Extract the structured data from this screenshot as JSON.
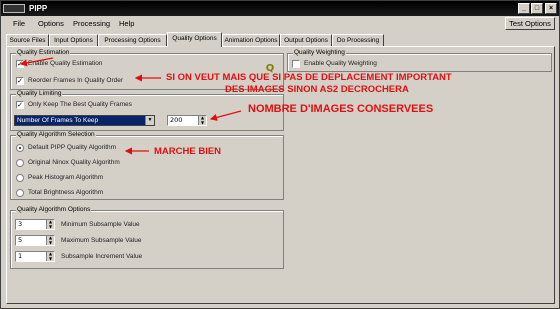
{
  "window": {
    "title": "PIPP",
    "minimize": "_",
    "maximize": "□",
    "close": "×"
  },
  "menu": {
    "file": "File",
    "options": "Options",
    "processing": "Processing",
    "help": "Help",
    "test_options": "Test Options"
  },
  "tabs": [
    {
      "label": "Source Files"
    },
    {
      "label": "Input Options"
    },
    {
      "label": "Processing Options"
    },
    {
      "label": "Quality Options"
    },
    {
      "label": "Animation Options"
    },
    {
      "label": "Output Options"
    },
    {
      "label": "Do Processing"
    }
  ],
  "quality_estimation": {
    "title": "Quality Estimation",
    "enable_label": "Enable Quality Estimation",
    "enable_checked": true,
    "reorder_label": "Reorder Frames In Quality Order",
    "reorder_checked": true,
    "q_glyph": "Q"
  },
  "quality_weighting": {
    "title": "Quality Weighting",
    "enable_label": "Enable Quality Weighting",
    "enable_checked": false
  },
  "quality_limiting": {
    "title": "Quality Limiting",
    "only_keep_label": "Only Keep The Best Quality Frames",
    "only_keep_checked": true,
    "mode_selected": "Number Of Frames To Keep",
    "frames_value": "200"
  },
  "algorithm_selection": {
    "title": "Quality Algorithm Selection",
    "options": [
      {
        "label": "Default PIPP Quality Algorithm",
        "selected": true
      },
      {
        "label": "Original Ninox Quality Algorithm",
        "selected": false
      },
      {
        "label": "Peak Histogram Algorithm",
        "selected": false
      },
      {
        "label": "Total Brightness Algorithm",
        "selected": false
      }
    ]
  },
  "algorithm_options": {
    "title": "Quality Algorithm Options",
    "rows": [
      {
        "value": "3",
        "label": "Minimum Subsample Value"
      },
      {
        "value": "5",
        "label": "Maximum Subsample Value"
      },
      {
        "value": "1",
        "label": "Subsample Increment Value"
      }
    ]
  },
  "annotations": {
    "line1": "SI ON VEUT MAIS QUE SI PAS DE DEPLACEMENT IMPORTANT",
    "line2": "DES IMAGES SINON AS2 DECROCHERA",
    "frames_note": "NOMBRE D'IMAGES CONSERVEES",
    "algo_note": "MARCHE BIEN",
    "color": "#e01010"
  }
}
